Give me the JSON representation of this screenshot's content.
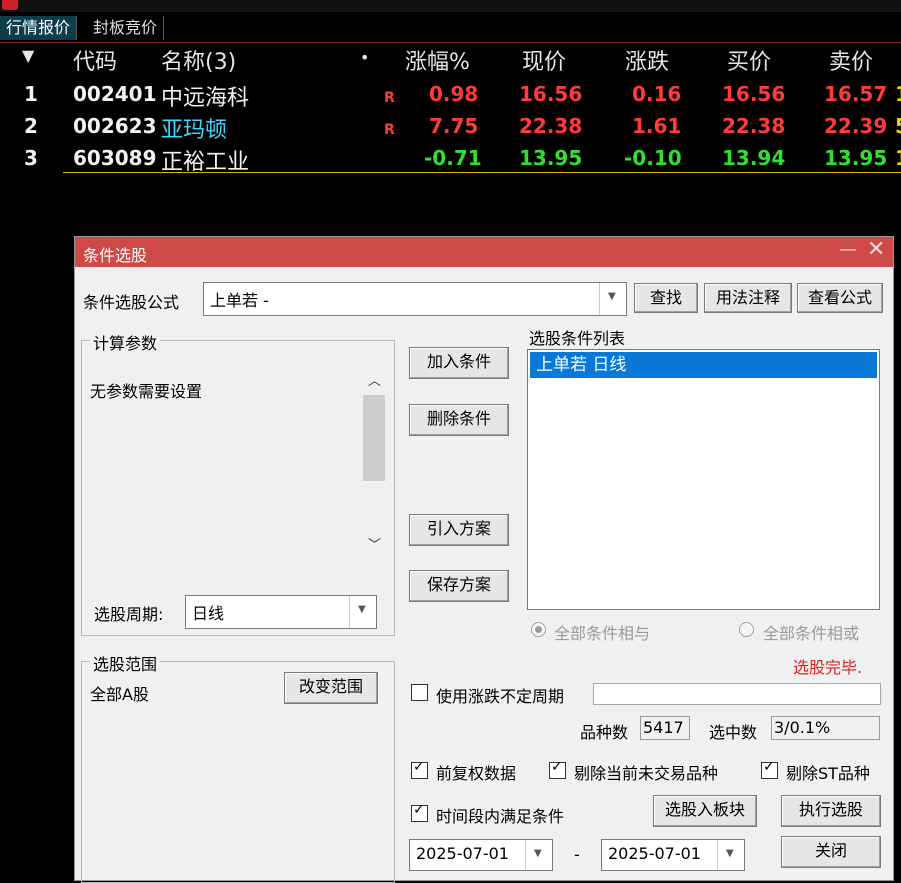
{
  "tabs": {
    "active": "行情报价",
    "other": "封板竞价"
  },
  "table": {
    "header": {
      "sort_icon": "triangle-down",
      "code": "代码",
      "name": "名称(3)",
      "dot": "•",
      "change_pct": "涨幅%",
      "price": "现价",
      "change": "涨跌",
      "bid": "买价",
      "ask": "卖价"
    },
    "rows": [
      {
        "idx": "1",
        "code": "002401",
        "name": "中远海科",
        "flag": "R",
        "change_pct": "0.98",
        "price": "16.56",
        "change": "0.16",
        "bid": "16.56",
        "ask": "16.57",
        "color": "red",
        "name_color": "white"
      },
      {
        "idx": "2",
        "code": "002623",
        "name": "亚玛顿",
        "flag": "R",
        "change_pct": "7.75",
        "price": "22.38",
        "change": "1.61",
        "bid": "22.38",
        "ask": "22.39",
        "color": "red",
        "name_color": "cyan"
      },
      {
        "idx": "3",
        "code": "603089",
        "name": "正裕工业",
        "flag": "",
        "change_pct": "-0.71",
        "price": "13.95",
        "change": "-0.10",
        "bid": "13.94",
        "ask": "13.95",
        "color": "green",
        "name_color": "white"
      }
    ]
  },
  "dialog": {
    "title": "条件选股",
    "minimize": "—",
    "close": "✕",
    "formula_label": "条件选股公式",
    "formula_value": "上单若  -",
    "find_btn": "查找",
    "usage_btn": "用法注释",
    "view_btn": "查看公式",
    "calc_params_legend": "计算参数",
    "no_params_text": "无参数需要设置",
    "period_label": "选股周期:",
    "period_value": "日线",
    "add_condition": "加入条件",
    "delete_condition": "删除条件",
    "import_plan": "引入方案",
    "save_plan": "保存方案",
    "condition_list_label": "选股条件列表",
    "conditions": [
      "上单若  日线"
    ],
    "radio_and": "全部条件相与",
    "radio_or": "全部条件相或",
    "status": "选股完毕.",
    "range_legend": "选股范围",
    "range_value": "全部A股",
    "change_range_btn": "改变范围",
    "use_uncertain_period": "使用涨跌不定周期",
    "count_label": "品种数",
    "count_value": "5417",
    "selected_label": "选中数",
    "selected_value": "3/0.1%",
    "chk_fq": "前复权数据",
    "chk_exclude_untraded": "剔除当前未交易品种",
    "chk_exclude_st": "剔除ST品种",
    "chk_time_range": "时间段内满足条件",
    "to_block_btn": "选股入板块",
    "run_btn": "执行选股",
    "date_from": "2025-07-01",
    "date_sep": "-",
    "date_to": "2025-07-01",
    "close_btn": "关闭"
  },
  "colors": {
    "red": "#ff3b3b",
    "green": "#2fe02f",
    "title_bar": "#cd4a47",
    "selection": "#0a78d7"
  }
}
